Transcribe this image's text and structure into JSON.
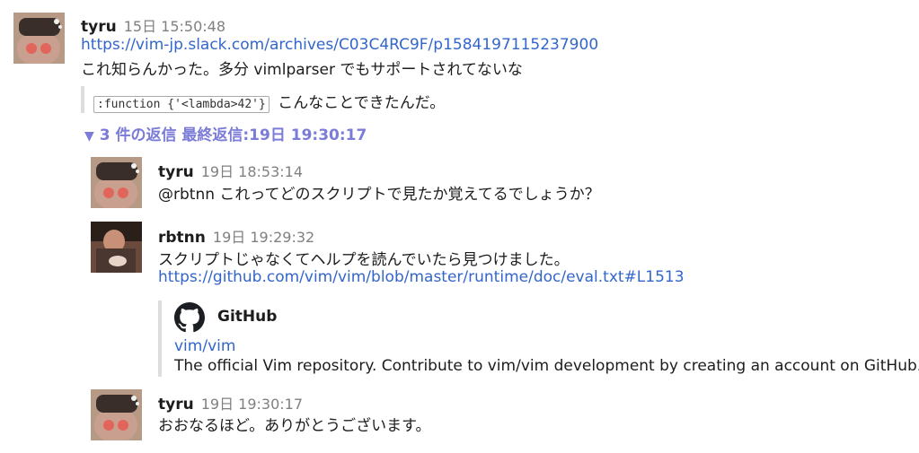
{
  "colors": {
    "link": "#3366cc",
    "thread_toggle": "#7b7bd8",
    "timestamp": "#808080",
    "quote_bar": "#dddddd"
  },
  "parent": {
    "user": "tyru",
    "time": "15日 15:50:48",
    "link": "https://vim-jp.slack.com/archives/C03C4RC9F/p1584197115237900",
    "text": "これ知らんかった。多分 vimlparser でもサポートされてないな",
    "quote_code": ":function {'<lambda>42'}",
    "quote_text": "こんなことできたんだ。"
  },
  "thread": {
    "toggle_icon": "▼",
    "toggle_label": "3 件の返信 最終返信:19日 19:30:17"
  },
  "replies": [
    {
      "user": "tyru",
      "time": "19日 18:53:14",
      "text": "@rbtnn これってどのスクリプトで見たか覚えてるでしょうか？"
    },
    {
      "user": "rbtnn",
      "time": "19日 19:29:32",
      "text": "スクリプトじゃなくてヘルプを読んでいたら見つけました。",
      "link": "https://github.com/vim/vim/blob/master/runtime/doc/eval.txt#L1513",
      "unfurl": {
        "icon": "github-icon",
        "site": "GitHub",
        "title": "vim/vim",
        "description": "The official Vim repository. Contribute to vim/vim development by creating an account on GitHub."
      }
    },
    {
      "user": "tyru",
      "time": "19日 19:30:17",
      "text": "おおなるほど。ありがとうございます。"
    }
  ]
}
